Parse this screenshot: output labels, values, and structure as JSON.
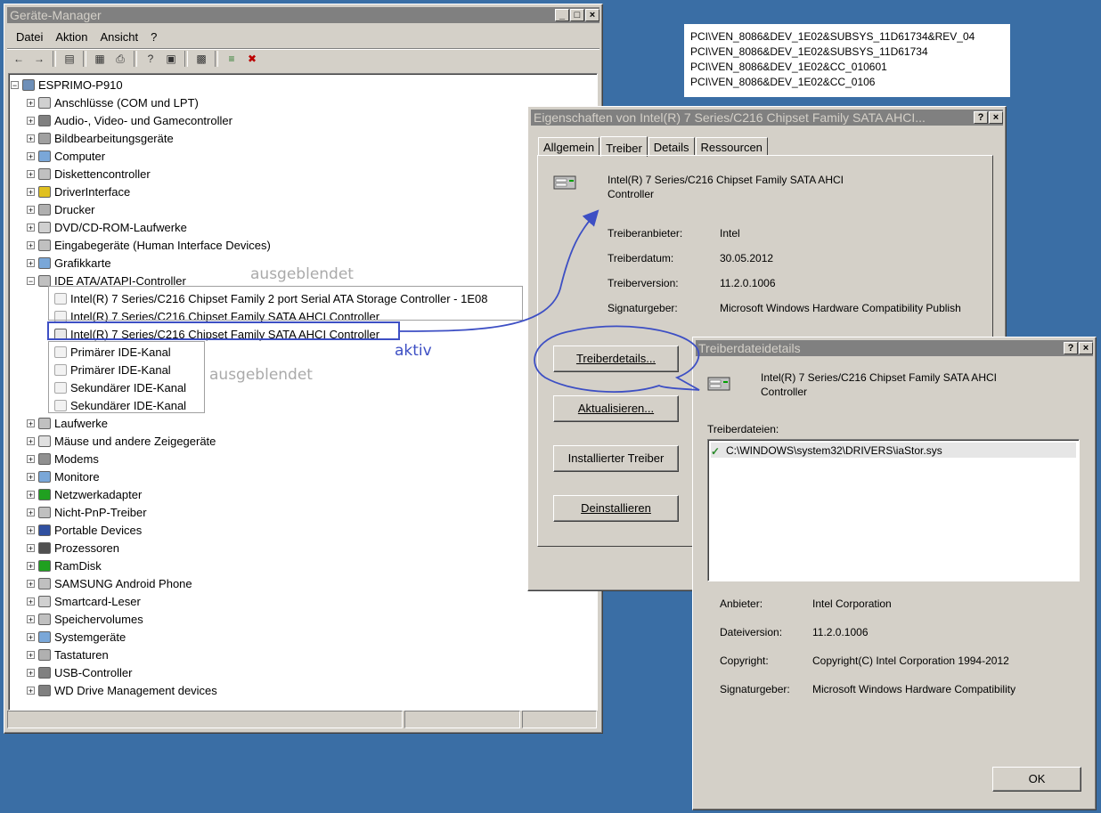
{
  "device_manager": {
    "title": "Geräte-Manager",
    "menu": [
      "Datei",
      "Aktion",
      "Ansicht",
      "?"
    ],
    "root": "ESPRIMO-P910",
    "categories_top": [
      "Anschlüsse (COM und LPT)",
      "Audio-, Video- und Gamecontroller",
      "Bildbearbeitungsgeräte",
      "Computer",
      "Diskettencontroller",
      "DriverInterface",
      "Drucker",
      "DVD/CD-ROM-Laufwerke",
      "Eingabegeräte (Human Interface Devices)",
      "Grafikkarte",
      "IDE ATA/ATAPI-Controller"
    ],
    "ide_children": [
      "Intel(R) 7 Series/C216 Chipset Family 2 port Serial ATA Storage Controller - 1E08",
      "Intel(R) 7 Series/C216 Chipset Family SATA AHCI Controller",
      "Intel(R) 7 Series/C216 Chipset Family SATA AHCI Controller",
      "Primärer IDE-Kanal",
      "Primärer IDE-Kanal",
      "Sekundärer IDE-Kanal",
      "Sekundärer IDE-Kanal"
    ],
    "categories_bottom": [
      "Laufwerke",
      "Mäuse und andere Zeigegeräte",
      "Modems",
      "Monitore",
      "Netzwerkadapter",
      "Nicht-PnP-Treiber",
      "Portable Devices",
      "Prozessoren",
      "RamDisk",
      "SAMSUNG Android Phone",
      "Smartcard-Leser",
      "Speichervolumes",
      "Systemgeräte",
      "Tastaturen",
      "USB-Controller",
      "WD Drive Management devices"
    ]
  },
  "annotations": {
    "hidden_top": "ausgeblendet",
    "hidden_bottom": "ausgeblendet",
    "active": "aktiv"
  },
  "hardware_ids": [
    "PCI\\VEN_8086&DEV_1E02&SUBSYS_11D61734&REV_04",
    "PCI\\VEN_8086&DEV_1E02&SUBSYS_11D61734",
    "PCI\\VEN_8086&DEV_1E02&CC_010601",
    "PCI\\VEN_8086&DEV_1E02&CC_0106"
  ],
  "properties": {
    "title": "Eigenschaften von Intel(R) 7 Series/C216 Chipset Family SATA AHCI...",
    "tabs": [
      "Allgemein",
      "Treiber",
      "Details",
      "Ressourcen"
    ],
    "device_name_line1": "Intel(R) 7 Series/C216 Chipset Family SATA AHCI",
    "device_name_line2": "Controller",
    "fields": [
      {
        "label": "Treiberanbieter:",
        "value": "Intel"
      },
      {
        "label": "Treiberdatum:",
        "value": "30.05.2012"
      },
      {
        "label": "Treiberversion:",
        "value": "11.2.0.1006"
      },
      {
        "label": "Signaturgeber:",
        "value": "Microsoft Windows Hardware Compatibility Publish"
      }
    ],
    "buttons": [
      "Treiberdetails...",
      "Aktualisieren...",
      "Installierter Treiber",
      "Deinstallieren"
    ]
  },
  "driver_details": {
    "title": "Treiberdateidetails",
    "device_name_line1": "Intel(R) 7 Series/C216 Chipset Family SATA AHCI",
    "device_name_line2": "Controller",
    "files_label": "Treiberdateien:",
    "files": [
      "C:\\WINDOWS\\system32\\DRIVERS\\iaStor.sys"
    ],
    "fields": [
      {
        "label": "Anbieter:",
        "value": "Intel Corporation"
      },
      {
        "label": "Dateiversion:",
        "value": "11.2.0.1006"
      },
      {
        "label": "Copyright:",
        "value": "Copyright(C) Intel Corporation 1994-2012"
      },
      {
        "label": "Signaturgeber:",
        "value": "Microsoft Windows Hardware Compatibility"
      }
    ],
    "ok_label": "OK"
  },
  "colors": {
    "desktop": "#3a6ea5",
    "annotation_blue": "#3d4fc4",
    "annotation_gray": "#aaaaaa"
  }
}
